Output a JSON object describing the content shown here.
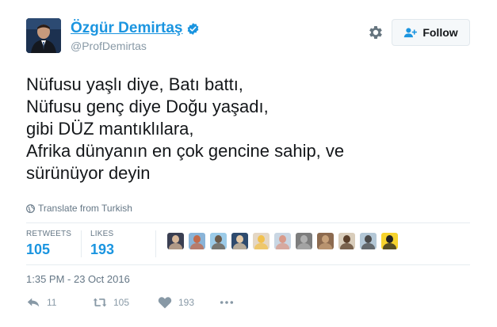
{
  "header": {
    "display_name": "Özgür Demirtaş",
    "handle": "@ProfDemirtas",
    "verified_icon": "verified-badge-icon",
    "follow_label": "Follow",
    "accent_color": "#1b95e0"
  },
  "tweet": {
    "text": "Nüfusu yaşlı diye, Batı battı,\nNüfusu genç diye Doğu yaşadı,\ngibi DÜZ mantıklılara,\nAfrika dünyanın en çok gencine sahip, ve\nsürünüyor deyin",
    "translate_label": "Translate from Turkish"
  },
  "stats": {
    "retweets_label": "RETWEETS",
    "retweets_value": "105",
    "likes_label": "LIKES",
    "likes_value": "193"
  },
  "likers": [
    {
      "bg": "#3a3f52",
      "fg": "#d8b89a"
    },
    {
      "bg": "#8ab4d8",
      "fg": "#c46a4a"
    },
    {
      "bg": "#9ccbe8",
      "fg": "#6a5a4a"
    },
    {
      "bg": "#2e4b6e",
      "fg": "#e3c9a8"
    },
    {
      "bg": "#e4d7c5",
      "fg": "#f2c14e"
    },
    {
      "bg": "#c9d6e3",
      "fg": "#d99a8a"
    },
    {
      "bg": "#7d7d7d",
      "fg": "#b0b0b0"
    },
    {
      "bg": "#8c6a4f",
      "fg": "#c7a17a"
    },
    {
      "bg": "#d9cdbb",
      "fg": "#5a3f2a"
    },
    {
      "bg": "#b3c7d6",
      "fg": "#4a4a4a"
    },
    {
      "bg": "#f6d32d",
      "fg": "#222222"
    }
  ],
  "timestamp": "1:35 PM - 23 Oct 2016",
  "actions": {
    "reply_count": "11",
    "retweet_count": "105",
    "like_count": "193"
  }
}
